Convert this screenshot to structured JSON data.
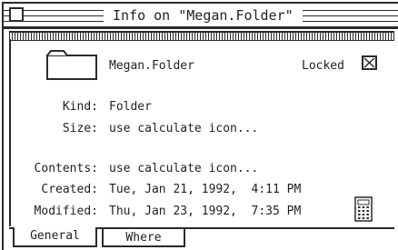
{
  "window": {
    "title": "Info on \"Megan.Folder\""
  },
  "item": {
    "name": "Megan.Folder",
    "locked_label": "Locked",
    "locked": true
  },
  "fields": [
    {
      "label": "Kind:",
      "value": "Folder"
    },
    {
      "label": "Size:",
      "value": "use calculate icon..."
    },
    {
      "label": "Contents:",
      "value": "use calculate icon..."
    },
    {
      "label": "Created:",
      "value": "Tue, Jan 21, 1992,  4:11 PM"
    },
    {
      "label": "Modified:",
      "value": "Thu, Jan 23, 1992,  7:35 PM"
    }
  ],
  "tabs": [
    {
      "label": "General",
      "selected": true
    },
    {
      "label": "Where",
      "selected": false
    }
  ],
  "icons": {
    "folder": "folder-icon",
    "calculator": "calculator-icon",
    "close": "close-box-icon"
  }
}
